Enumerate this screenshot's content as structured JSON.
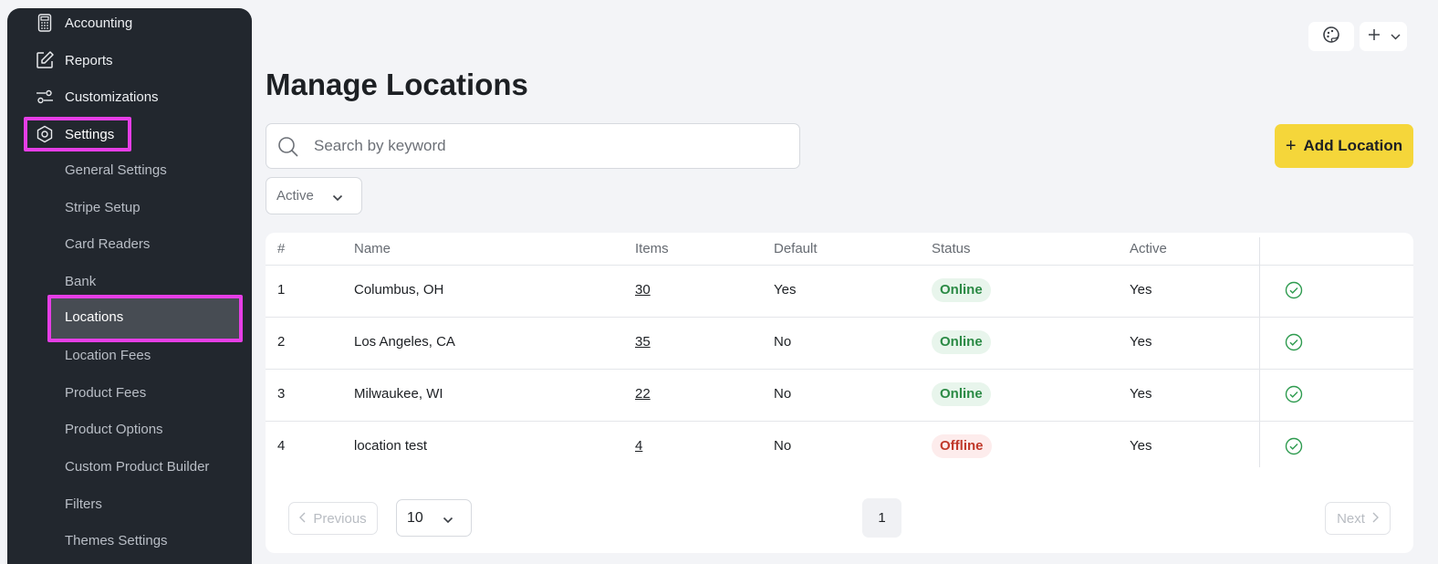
{
  "sidebar": {
    "nav": [
      {
        "label": "Accounting",
        "icon": "calculator-icon"
      },
      {
        "label": "Reports",
        "icon": "edit-icon"
      },
      {
        "label": "Customizations",
        "icon": "sliders-icon"
      },
      {
        "label": "Settings",
        "icon": "gear-icon"
      }
    ],
    "sub": [
      "General Settings",
      "Stripe Setup",
      "Card Readers",
      "Bank",
      "Locations",
      "Location Fees",
      "Product Fees",
      "Product Options",
      "Custom Product Builder",
      "Filters",
      "Themes Settings"
    ]
  },
  "header": {
    "icons": [
      "palette-icon",
      "plus-icon",
      "chevron-down-icon"
    ]
  },
  "main": {
    "title": "Manage Locations",
    "search_placeholder": "Search by keyword",
    "add_button": "Add Location",
    "filter_value": "Active"
  },
  "table": {
    "columns": [
      "#",
      "Name",
      "Items",
      "Default",
      "Status",
      "Active"
    ],
    "rows": [
      {
        "num": "1",
        "name": "Columbus, OH",
        "items": "30",
        "default": "Yes",
        "status": "Online",
        "active": "Yes"
      },
      {
        "num": "2",
        "name": "Los Angeles, CA",
        "items": "35",
        "default": "No",
        "status": "Online",
        "active": "Yes"
      },
      {
        "num": "3",
        "name": "Milwaukee, WI",
        "items": "22",
        "default": "No",
        "status": "Online",
        "active": "Yes"
      },
      {
        "num": "4",
        "name": "location test",
        "items": "4",
        "default": "No",
        "status": "Offline",
        "active": "Yes"
      }
    ]
  },
  "pagination": {
    "previous": "Previous",
    "next": "Next",
    "page_size": "10",
    "current_page": "1"
  },
  "colors": {
    "sidebar_bg": "#22272e",
    "highlight": "#e63ee6",
    "accent_yellow": "#f5d63a",
    "online": "#2b8a45",
    "offline": "#c0392b"
  }
}
